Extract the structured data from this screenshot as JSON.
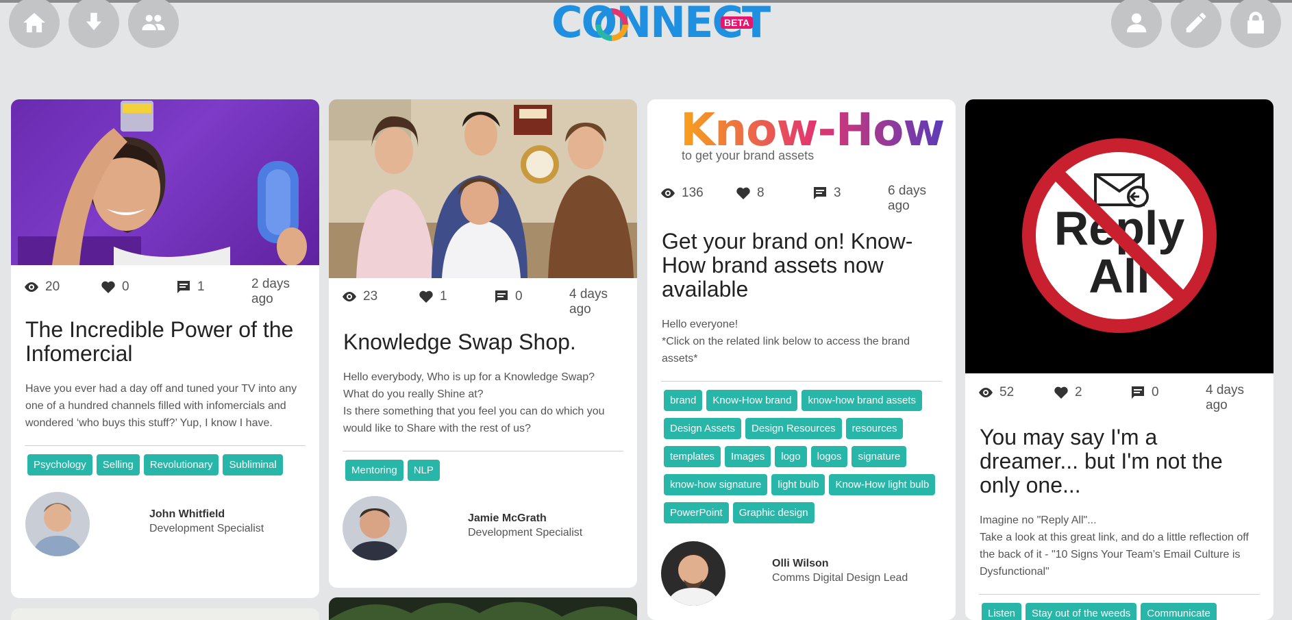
{
  "header": {
    "logo_text": "CONNECT",
    "logo_badge": "BETA",
    "nav_left": [
      {
        "name": "home-icon"
      },
      {
        "name": "download-icon"
      },
      {
        "name": "people-icon"
      }
    ],
    "nav_right": [
      {
        "name": "profile-icon"
      },
      {
        "name": "edit-icon"
      },
      {
        "name": "lock-icon"
      }
    ],
    "colors": {
      "accent": "#27b6a8",
      "brand_blue": "#1f8fe0",
      "brand_pink": "#e2186f"
    }
  },
  "cards": [
    {
      "image": "Man balancing object on head holding hairbrush",
      "views": "20",
      "likes": "0",
      "comments": "1",
      "ago": "2 days ago",
      "title": "The Incredible Power of the Infomercial",
      "excerpt": "Have you ever had a day off and tuned your TV into any one of a hundred channels filled with infomercials and wondered ‘who buys this stuff?’ Yup, I know I have.",
      "tags": [
        "Psychology",
        "Selling",
        "Revolutionary",
        "Subliminal"
      ],
      "author_name": "John Whitfield",
      "author_role": "Development Specialist"
    },
    {
      "image": "Swap Shop presenters",
      "views": "23",
      "likes": "1",
      "comments": "0",
      "ago": "4 days ago",
      "title": "Knowledge Swap Shop.",
      "excerpt_lines": [
        "Hello everybody, Who is up for a Knowledge Swap? What do you really Shine at?",
        "Is there something that you feel you can do which you would like to Share with the rest of us?"
      ],
      "tags": [
        "Mentoring",
        "NLP"
      ],
      "author_name": "Jamie McGrath",
      "author_role": "Development Specialist"
    },
    {
      "image_heading": "Know-How",
      "image_subheading": "to get your brand assets",
      "views": "136",
      "likes": "8",
      "comments": "3",
      "ago": "6 days ago",
      "title": "Get your brand on! Know-How brand assets now available",
      "excerpt_lines": [
        "Hello everyone!",
        "*Click on the related link below to access the brand assets*"
      ],
      "tags": [
        "brand",
        "Know-How brand",
        "know-how brand assets",
        "Design Assets",
        "Design Resources",
        "resources",
        "templates",
        "Images",
        "logo",
        "logos",
        "signature",
        "know-how signature",
        "light bulb",
        "Know-How light bulb",
        "PowerPoint",
        "Graphic design"
      ],
      "author_name": "Olli Wilson",
      "author_role": "Comms Digital Design Lead"
    },
    {
      "image_word1": "Reply",
      "image_word2": "All",
      "views": "52",
      "likes": "2",
      "comments": "0",
      "ago": "4 days ago",
      "title": "You may say I'm a dreamer... but I'm not the only one...",
      "excerpt_lines": [
        "Imagine no \"Reply All\"...",
        "Take a look at this great link, and do a little reflection off the back of it - \"10 Signs Your Team’s Email Culture is Dysfunctional\""
      ],
      "tags": [
        "Listen",
        "Stay out of the weeds",
        "Communicate"
      ]
    }
  ]
}
